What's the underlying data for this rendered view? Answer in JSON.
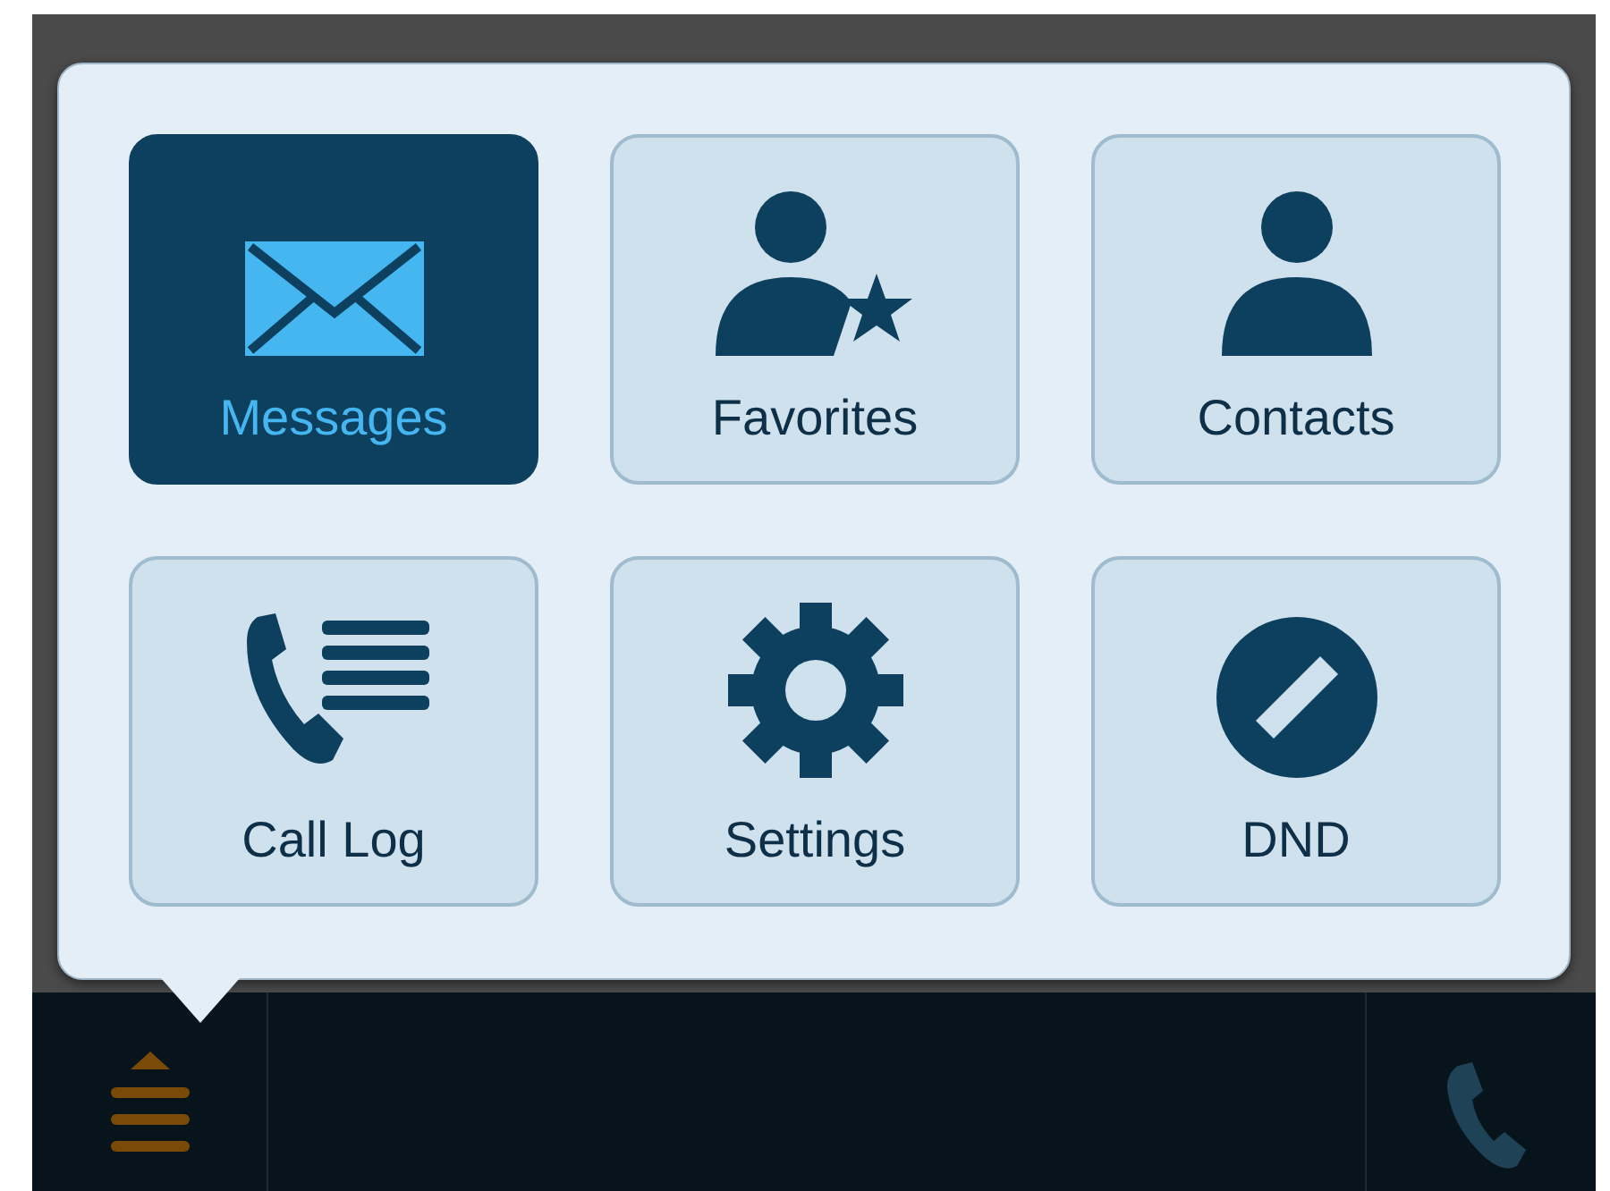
{
  "menu": {
    "tiles": [
      {
        "label": "Messages",
        "selected": true
      },
      {
        "label": "Favorites",
        "selected": false
      },
      {
        "label": "Contacts",
        "selected": false
      },
      {
        "label": "Call Log",
        "selected": false
      },
      {
        "label": "Settings",
        "selected": false
      },
      {
        "label": "DND",
        "selected": false
      }
    ]
  },
  "bottom_bar": {
    "menu_button": {
      "expanded": true
    }
  }
}
